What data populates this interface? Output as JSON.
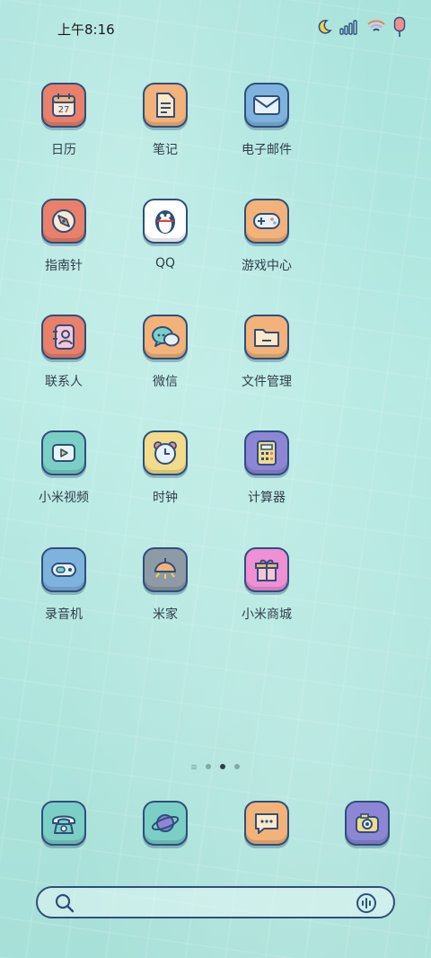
{
  "status": {
    "time": "上午8:16"
  },
  "apps": [
    {
      "label": "日历",
      "icon": "calendar-icon",
      "day": "27"
    },
    {
      "label": "笔记",
      "icon": "notes-icon"
    },
    {
      "label": "电子邮件",
      "icon": "mail-icon"
    },
    {
      "label": "指南针",
      "icon": "compass-icon"
    },
    {
      "label": "QQ",
      "icon": "penguin-icon"
    },
    {
      "label": "游戏中心",
      "icon": "gamepad-icon"
    },
    {
      "label": "联系人",
      "icon": "contacts-icon"
    },
    {
      "label": "微信",
      "icon": "chat-bubbles-icon"
    },
    {
      "label": "文件管理",
      "icon": "folder-icon"
    },
    {
      "label": "小米视频",
      "icon": "video-icon"
    },
    {
      "label": "时钟",
      "icon": "clock-icon"
    },
    {
      "label": "计算器",
      "icon": "calculator-icon"
    },
    {
      "label": "录音机",
      "icon": "recorder-icon"
    },
    {
      "label": "米家",
      "icon": "lamp-icon"
    },
    {
      "label": "小米商城",
      "icon": "gift-icon"
    }
  ],
  "dock": [
    {
      "icon": "phone-icon"
    },
    {
      "icon": "browser-planet-icon"
    },
    {
      "icon": "messages-icon"
    },
    {
      "icon": "camera-icon"
    }
  ],
  "page_indicator": {
    "pages": 3,
    "current": 2
  },
  "colors": {
    "outline": "#2f4f7a",
    "peach": "#f3b27a",
    "coral": "#e9806b",
    "blue": "#7fb3de",
    "teal": "#7ccfc6",
    "yellow": "#f2dc8a",
    "purple": "#8d86d6",
    "pink": "#ef8fd6",
    "gray": "#8e9aa6"
  }
}
